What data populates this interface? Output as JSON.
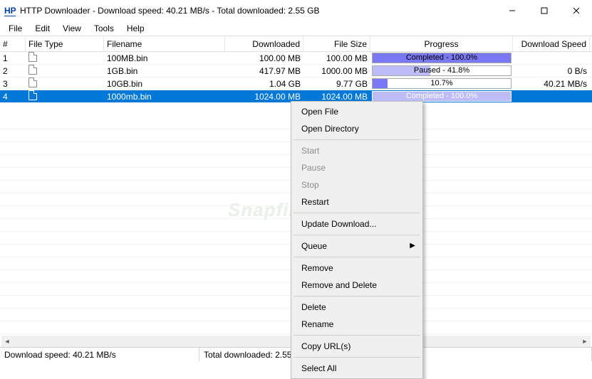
{
  "title": "HTTP Downloader - Download speed:  40.21 MB/s - Total downloaded:  2.55 GB",
  "menubar": [
    "File",
    "Edit",
    "View",
    "Tools",
    "Help"
  ],
  "columns": {
    "num": "#",
    "type": "File Type",
    "name": "Filename",
    "downloaded": "Downloaded",
    "size": "File Size",
    "progress": "Progress",
    "speed": "Download Speed"
  },
  "rows": [
    {
      "num": "1",
      "name": "100MB.bin",
      "downloaded": "100.00 MB",
      "size": "100.00 MB",
      "progress_label": "Completed - 100.0%",
      "fill": 100,
      "fill_style": "solid",
      "speed": ""
    },
    {
      "num": "2",
      "name": "1GB.bin",
      "downloaded": "417.97 MB",
      "size": "1000.00 MB",
      "progress_label": "Paused - 41.8%",
      "fill": 41.8,
      "fill_style": "light",
      "speed": "0 B/s"
    },
    {
      "num": "3",
      "name": "10GB.bin",
      "downloaded": "1.04 GB",
      "size": "9.77 GB",
      "progress_label": "10.7%",
      "fill": 10.7,
      "fill_style": "solid",
      "speed": "40.21 MB/s"
    },
    {
      "num": "4",
      "name": "1000mb.bin",
      "downloaded": "1024.00 MB",
      "size": "1024.00 MB",
      "progress_label": "Completed - 100.0%",
      "fill": 100,
      "fill_style": "light",
      "speed": "",
      "selected": true
    }
  ],
  "context_menu": [
    {
      "label": "Open File",
      "enabled": true
    },
    {
      "label": "Open Directory",
      "enabled": true
    },
    {
      "sep": true
    },
    {
      "label": "Start",
      "enabled": false
    },
    {
      "label": "Pause",
      "enabled": false
    },
    {
      "label": "Stop",
      "enabled": false
    },
    {
      "label": "Restart",
      "enabled": true
    },
    {
      "sep": true
    },
    {
      "label": "Update Download...",
      "enabled": true
    },
    {
      "sep": true
    },
    {
      "label": "Queue",
      "enabled": true,
      "submenu": true
    },
    {
      "sep": true
    },
    {
      "label": "Remove",
      "enabled": true
    },
    {
      "label": "Remove and Delete",
      "enabled": true
    },
    {
      "sep": true
    },
    {
      "label": "Delete",
      "enabled": true
    },
    {
      "label": "Rename",
      "enabled": true
    },
    {
      "sep": true
    },
    {
      "label": "Copy URL(s)",
      "enabled": true
    },
    {
      "sep": true
    },
    {
      "label": "Select All",
      "enabled": true
    }
  ],
  "status": {
    "speed": "Download speed:  40.21 MB/s",
    "total": "Total downloaded:  2.55 GB"
  },
  "watermark": "Snapfiles"
}
